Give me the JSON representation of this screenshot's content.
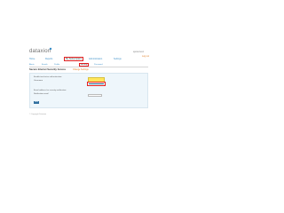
{
  "header": {
    "logo": "dataxion",
    "user": "ajusterlevel",
    "logout": "Log out"
  },
  "nav": {
    "items": [
      "Home",
      "Reports",
      "My Subscriptions",
      "Administration",
      "Settings"
    ],
    "active_index": 2
  },
  "subnav": {
    "items": [
      "Alerts",
      "Emails",
      "Profile",
      "Security",
      "Password"
    ],
    "active_index": 3
  },
  "section": {
    "title": "Secure Internet Security Access",
    "link": "Change Settings"
  },
  "form": {
    "line1": "Enable two-factor authentication:",
    "line2": "Username",
    "line3": "Email address for security notification:",
    "line4": "Notification email",
    "save_label": "Save"
  },
  "footer": {
    "text": "© Copyright Dataxion"
  },
  "colors": {
    "accent": "#3b8fc8",
    "highlight": "#e02020",
    "button_yellow": "#ffe65a"
  }
}
